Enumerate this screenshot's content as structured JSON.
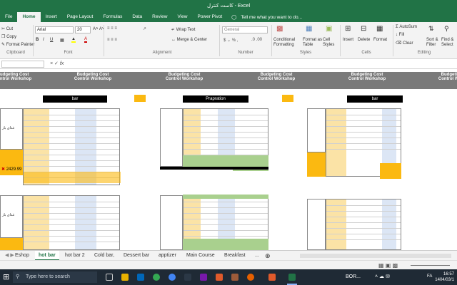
{
  "window": {
    "title": "کاست کنترل - Excel"
  },
  "menu": {
    "tabs": [
      "File",
      "Home",
      "Insert",
      "Page Layout",
      "Formulas",
      "Data",
      "Review",
      "View",
      "Power Pivot"
    ],
    "tell_me": "Tell me what you want to do..."
  },
  "ribbon": {
    "clipboard": {
      "cut": "Cut",
      "copy": "Copy",
      "format_painter": "Format Painter",
      "group": "Clipboard"
    },
    "font": {
      "name": "Arial",
      "size": "20",
      "group": "Font"
    },
    "alignment": {
      "wrap_text": "Wrap Text",
      "merge_center": "Merge & Center",
      "group": "Alignment"
    },
    "number": {
      "format": "General",
      "group": "Number"
    },
    "styles": {
      "conditional": "Conditional Formatting",
      "format_as_table": "Format as Table",
      "cell_styles": "Cell Styles",
      "group": "Styles"
    },
    "cells": {
      "insert": "Insert",
      "delete": "Delete",
      "format": "Format",
      "group": "Cells"
    },
    "editing": {
      "autosum": "AutoSum",
      "fill": "Fill",
      "clear": "Clear",
      "sort_filter": "Sort & Filter",
      "find_select": "Find & Select",
      "group": "Editing"
    }
  },
  "sheet": {
    "banner_logo": "Budgeting Cost Control Workshop",
    "headers": [
      "bar",
      "Prapration",
      "bar"
    ],
    "side_labels": [
      "غذای بار",
      "غذای بار"
    ],
    "amount": "2429.99"
  },
  "sheet_tabs": [
    "Eshop",
    "hot bar",
    "hot bar 2",
    "Cold bar,",
    "Dessert bar",
    "apptizer",
    "Main Course",
    "Breakfast",
    "..."
  ],
  "active_tab": "hot bar",
  "taskbar": {
    "search_placeholder": "Type here to search",
    "app_label": "BOR...",
    "time": "16:57",
    "date": "1404/03/1",
    "lang": "FA"
  }
}
